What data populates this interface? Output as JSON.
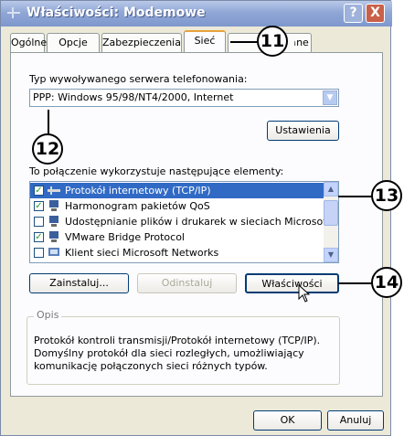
{
  "window": {
    "title": "Właściwości: Modemowe",
    "help_button": "?",
    "close_button": "X"
  },
  "tabs": [
    {
      "label": "Ogólne"
    },
    {
      "label": "Opcje"
    },
    {
      "label": "Zabezpieczenia"
    },
    {
      "label": "Sieć",
      "active": true
    },
    {
      "label": "Zaawansowane"
    }
  ],
  "server": {
    "label": "Typ wywoływanego serwera telefonowania:",
    "value": "PPP: Windows 95/98/NT4/2000, Internet",
    "settings_button": "Ustawienia"
  },
  "components": {
    "label": "To połączenie wykorzystuje następujące elementy:",
    "items": [
      {
        "label": "Protokół internetowy (TCP/IP)",
        "checked": true,
        "selected": true,
        "icon": "protocol-icon"
      },
      {
        "label": "Harmonogram pakietów QoS",
        "checked": true,
        "selected": false,
        "icon": "service-icon"
      },
      {
        "label": "Udostępnianie plików i drukarek w sieciach Microsoft ...",
        "checked": false,
        "selected": false,
        "icon": "service-icon"
      },
      {
        "label": "VMware Bridge Protocol",
        "checked": true,
        "selected": false,
        "icon": "service-icon"
      },
      {
        "label": "Klient sieci Microsoft Networks",
        "checked": false,
        "selected": false,
        "icon": "client-icon"
      }
    ],
    "install_button": "Zainstaluj...",
    "uninstall_button": "Odinstaluj",
    "properties_button": "Właściwości"
  },
  "description": {
    "legend": "Opis",
    "text_lines": [
      "Protokół kontroli transmisji/Protokół internetowy (TCP/IP).",
      "Domyślny protokół dla sieci rozległych, umożliwiający",
      "komunikację połączonych sieci różnych typów."
    ]
  },
  "footer": {
    "ok_button": "OK",
    "cancel_button": "Anuluj"
  },
  "callouts": [
    "11",
    "12",
    "13",
    "14"
  ],
  "colors": {
    "title_gradient": "#8fa7d6",
    "selection": "#316ac5",
    "tab_highlight": "#e8a23a"
  }
}
